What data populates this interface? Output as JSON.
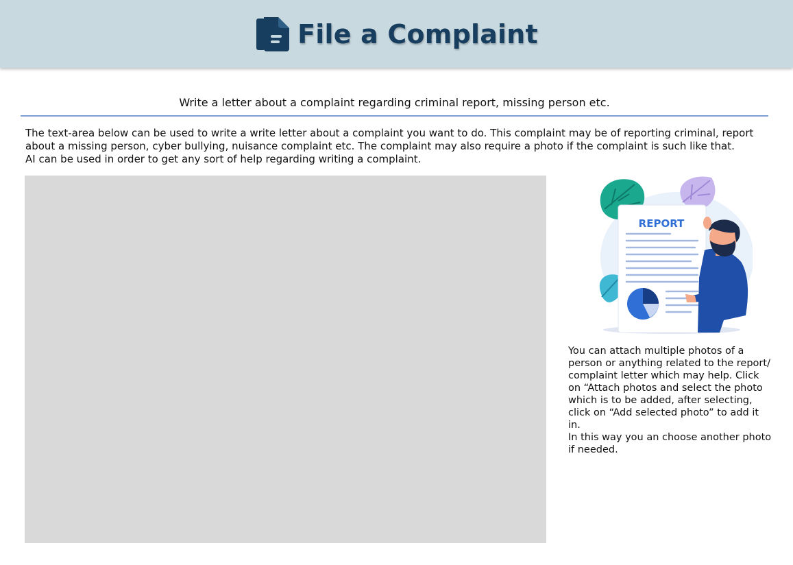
{
  "header": {
    "title": "File a Complaint",
    "icon": "document-icon",
    "background_color": "#c8d9e0",
    "title_color": "#173e5e"
  },
  "subtitle": "Write a letter about a complaint regarding criminal report, missing person etc.",
  "intro": {
    "line1": "The text-area below can be used to write a write letter about a complaint you want to do. This complaint may be of reporting criminal, report",
    "line2": "about a missing person, cyber bullying, nuisance complaint etc. The complaint may also require a photo if the complaint is such like that.",
    "line3": "AI can be used in order to get any sort of help regarding writing a complaint."
  },
  "letter_area": {
    "value": "",
    "placeholder": "",
    "background_color": "#d9d9d9"
  },
  "illustration": {
    "label": "REPORT",
    "icon": "report-illustration"
  },
  "side_text": {
    "lines": [
      "You can attach multiple photos of a",
      "person or anything related to the report/",
      "complaint letter which may help. Click",
      "on “Attach photos and select the photo",
      "which is to be added, after selecting,",
      "click on “Add selected photo” to add it in.",
      "In this way you an choose another photo",
      "if needed."
    ]
  }
}
